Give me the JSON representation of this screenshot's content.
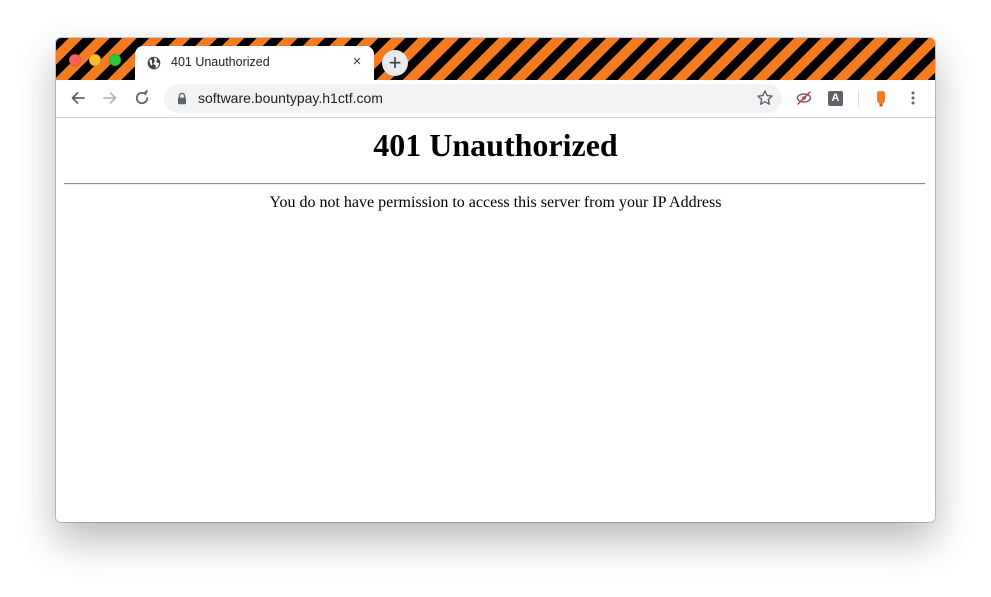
{
  "browser": {
    "tab": {
      "title": "401 Unauthorized",
      "favicon": "globe-icon",
      "close_symbol": "×"
    },
    "new_tab_symbol": "+",
    "address_bar": {
      "url": "software.bountypay.h1ctf.com",
      "secure_icon": "lock-icon"
    },
    "extensions": {
      "translate_label": "A"
    },
    "theme_colors": {
      "stripe_dark": "#000000",
      "stripe_accent": "#f47b20"
    }
  },
  "page": {
    "heading": "401 Unauthorized",
    "message": "You do not have permission to access this server from your IP Address"
  }
}
